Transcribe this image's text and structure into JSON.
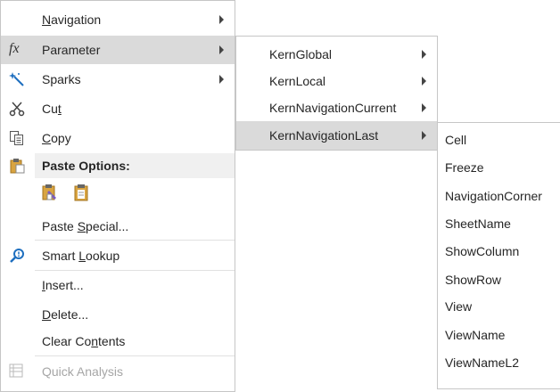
{
  "menu": {
    "navigation": {
      "pre": "",
      "key": "N",
      "post": "avigation"
    },
    "parameter": {
      "label": "Parameter",
      "icon": "function-fx-icon",
      "icon_text": "fx"
    },
    "sparks": {
      "label": "Sparks",
      "icon": "sparkle-wand-icon"
    },
    "cut": {
      "pre": "Cu",
      "key": "t",
      "post": "",
      "icon": "scissors-icon"
    },
    "copy": {
      "pre": "",
      "key": "C",
      "post": "opy",
      "icon": "copy-icon"
    },
    "paste_options": {
      "label": "Paste Options:",
      "icon": "clipboard-icon"
    },
    "paste_buttons": [
      "paste-formatting-icon",
      "paste-clipboard-icon"
    ],
    "paste_special": {
      "pre": "Paste ",
      "key": "S",
      "post": "pecial..."
    },
    "smart_lookup": {
      "pre": "Smart ",
      "key": "L",
      "post": "ookup",
      "icon": "smart-lookup-icon"
    },
    "insert": {
      "pre": "",
      "key": "I",
      "post": "nsert..."
    },
    "delete": {
      "pre": "",
      "key": "D",
      "post": "elete..."
    },
    "clear_contents": {
      "pre": "Clear Co",
      "key": "n",
      "post": "tents"
    },
    "quick_analysis": {
      "label": "Quick Analysis",
      "icon": "quick-analysis-icon"
    }
  },
  "submenu": {
    "items": [
      "KernGlobal",
      "KernLocal",
      "KernNavigationCurrent",
      "KernNavigationLast"
    ]
  },
  "submenu2": {
    "items": [
      "Cell",
      "Freeze",
      "NavigationCorner",
      "SheetName",
      "ShowColumn",
      "ShowRow",
      "View",
      "ViewName",
      "ViewNameL2"
    ]
  },
  "colors": {
    "hover": "#dadada",
    "menu_border": "#c6c6c6",
    "text": "#262626",
    "accent_blue": "#1e6fbf",
    "paste_gold": "#d9a441"
  }
}
